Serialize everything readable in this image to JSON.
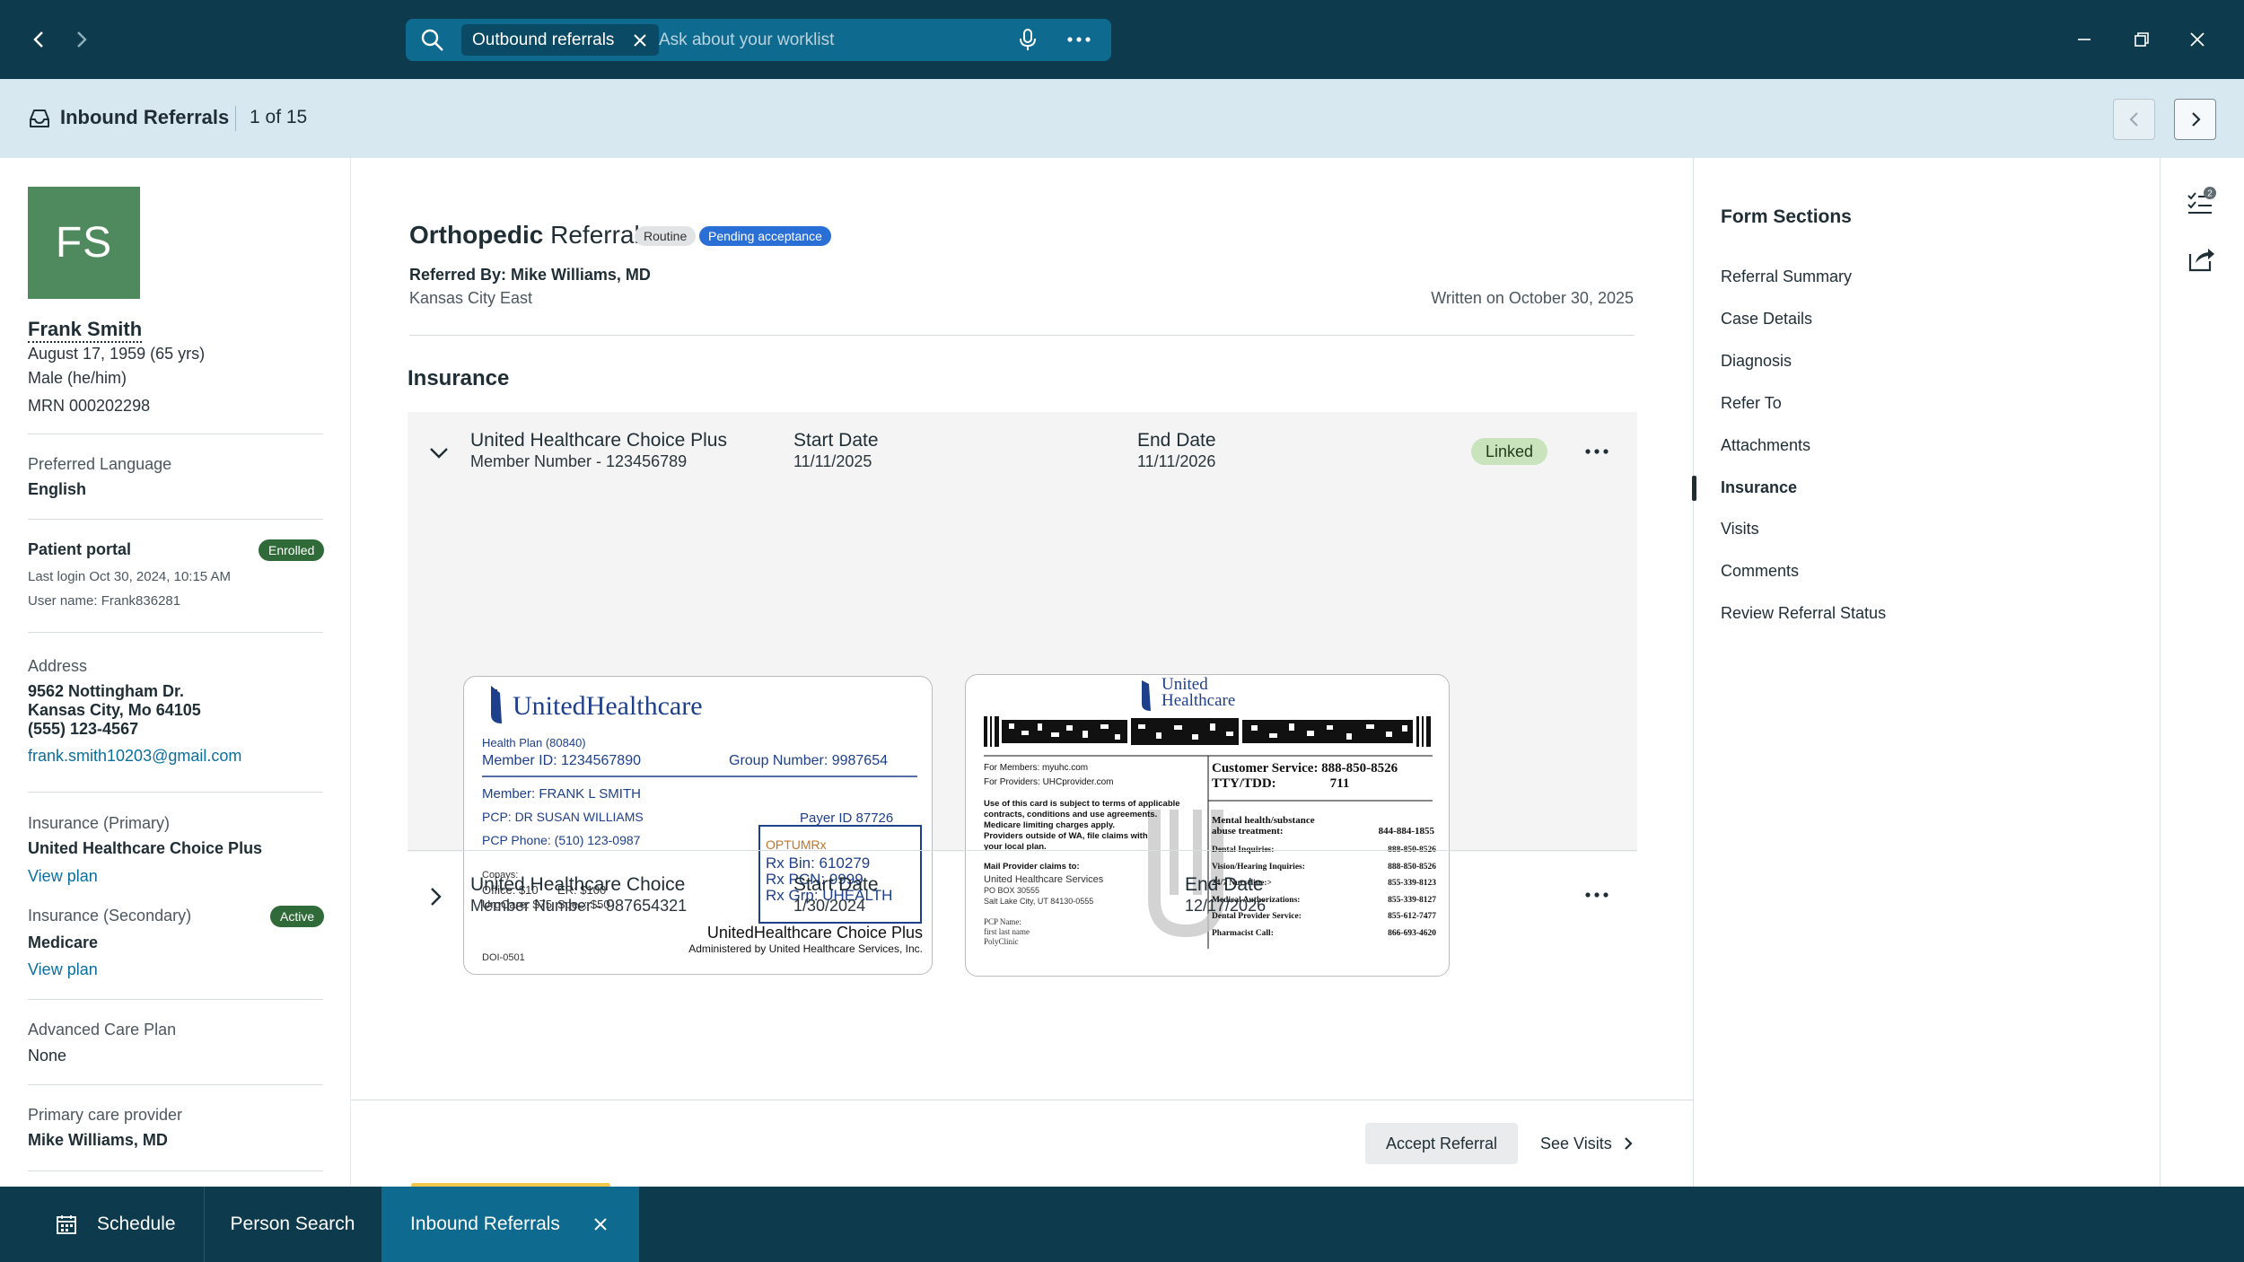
{
  "topbar": {
    "back_icon": "chevron-left-icon",
    "forward_icon": "chevron-right-icon",
    "search": {
      "chip_label": "Outbound referrals",
      "placeholder": "Ask about your worklist"
    }
  },
  "header": {
    "title": "Inbound Referrals",
    "count": "1 of 15"
  },
  "patient": {
    "initials": "FS",
    "avatar_color": "#4e8a5d",
    "name": "Frank Smith",
    "dob": "August 17, 1959 (65 yrs)",
    "sex": "Male (he/him)",
    "mrn": "MRN 000202298",
    "language_label": "Preferred Language",
    "language": "English",
    "portal_label": "Patient portal",
    "portal_status": "Enrolled",
    "last_login": "Last login Oct 30, 2024, 10:15 AM",
    "username": "User name: Frank836281",
    "address_label": "Address",
    "address_line1": "9562 Nottingham Dr.",
    "address_line2": "Kansas City, Mo 64105",
    "phone": "(555) 123-4567",
    "email": "frank.smith10203@gmail.com",
    "ins_primary_label": "Insurance (Primary)",
    "ins_primary": "United Healthcare Choice Plus",
    "view_plan": "View plan",
    "ins_secondary_label": "Insurance (Secondary)",
    "ins_secondary_status": "Active",
    "ins_secondary": "Medicare",
    "acp_label": "Advanced Care Plan",
    "acp": "None",
    "pcp_label": "Primary care provider",
    "pcp": "Mike Williams, MD"
  },
  "referral": {
    "title_bold": "Orthopedic",
    "title_rest": " Referral",
    "tag_routine": "Routine",
    "tag_pending": "Pending acceptance",
    "referred_by": "Referred By: Mike Williams, MD",
    "location": "Kansas City East",
    "written": "Written on October 30, 2025",
    "insurance_heading": "Insurance",
    "plans": [
      {
        "name": "United Healthcare Choice Plus",
        "member": "Member Number - 123456789",
        "start_label": "Start Date",
        "start": "11/11/2025",
        "end_label": "End Date",
        "end": "11/11/2026",
        "status": "Linked"
      },
      {
        "name": "United Healthcare Choice",
        "member": "Member Number - 987654321",
        "start_label": "Start Date",
        "start": "1/30/2024",
        "end_label": "End Date",
        "end": "12/17/2026"
      }
    ],
    "card_front": {
      "brand": "UnitedHealthcare",
      "health_plan": "Health Plan (80840)",
      "member_id": "Member ID:  1234567890",
      "group_number": "Group Number:  9987654",
      "member": "Member:   FRANK L SMITH",
      "pcp": "PCP:   DR SUSAN WILLIAMS",
      "pcp_phone": "PCP Phone:  (510) 123-0987",
      "payer_id": "Payer ID 87726",
      "copays": "Copays:",
      "office": "Office: $10",
      "er": "ER: $100",
      "urgcare": "UrgCare: $75",
      "spec": "Spec: $50",
      "optum": "OPTUMRx",
      "rx_bin": "Rx Bin:   610279",
      "rx_pcn": "Rx PCN:   9999",
      "rx_grp": "Rx Grp:   UHEALTH",
      "plan_name": "UnitedHealthcare Choice Plus",
      "administered": "Administered by United Healthcare Services, Inc.",
      "doi": "DOI-0501"
    },
    "card_back": {
      "brand_line1": "United",
      "brand_line2": "Healthcare",
      "for_members": "For Members:   myuhc.com",
      "for_providers": "For Providers:   UHCprovider.com",
      "cust_service": "Customer Service:  888-850-8526",
      "tty": "TTY/TDD:                711",
      "disclaimer1": "Use of this card is subject to terms of applicable",
      "disclaimer2": "contracts, conditions and use agreements.",
      "disclaimer3": "Medicare limiting charges apply.",
      "disclaimer4": "Providers outside of WA, file claims with",
      "disclaimer5": "your local plan.",
      "mail_claims": "Mail Provider claims to:",
      "mail1": "United Healthcare Services",
      "mail2": "PO BOX 30555",
      "mail3": "Salt Lake City, UT 84130-0555",
      "pcp_name": "PCP Name:",
      "first_last": "first last name",
      "polyclinic": "PolyClinic",
      "mh_label": "Mental health/substance abuse treatment:",
      "mh_phone": "844-884-1855",
      "dental": "Dental Inquiries:",
      "dental_phone": "888-850-8526",
      "vision": "Vision/Hearing Inquiries:",
      "vision_phone": "888-850-8526",
      "nurse": "24/7 Nurseline:>",
      "nurse_phone": "855-339-8123",
      "medauth": "Medical Authorizations:",
      "medauth_phone": "855-339-8127",
      "dentalprov": "Dental Provider Service:",
      "dentalprov_phone": "855-612-7477",
      "pharm": "Pharmacist Call:",
      "pharm_phone": "866-693-4620"
    },
    "accept_button": "Accept Referral",
    "see_visits_button": "See Visits"
  },
  "form_sections": {
    "title": "Form Sections",
    "items": [
      "Referral Summary",
      "Case Details",
      "Diagnosis",
      "Refer To",
      "Attachments",
      "Insurance",
      "Visits",
      "Comments",
      "Review Referral Status"
    ],
    "active": "Insurance"
  },
  "rail": {
    "tasks_badge": "2"
  },
  "taskbar": {
    "items": [
      "Schedule",
      "Person Search",
      "Inbound Referrals"
    ]
  },
  "colors": {
    "topbar": "#0d3a4c",
    "accent": "#0e6a8e",
    "header_band": "#d7e8f0",
    "pending": "#2a6fd6",
    "enrolled": "#2f6a38",
    "linked": "#c9e4bd"
  }
}
